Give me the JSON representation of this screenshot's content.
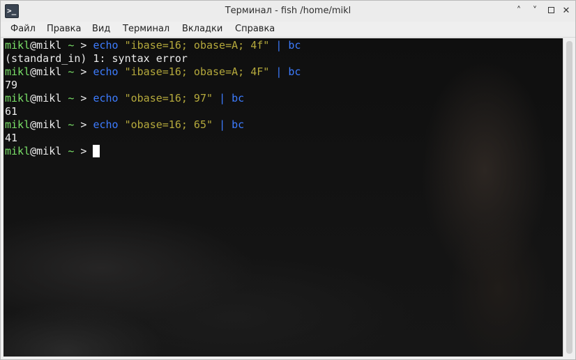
{
  "window": {
    "title": "Терминал - fish /home/mikl",
    "app_icon_glyph": ">_",
    "controls": {
      "minimize": "˄",
      "restore": "˅",
      "close": "✕"
    }
  },
  "menu": {
    "items": [
      "Файл",
      "Правка",
      "Вид",
      "Терминал",
      "Вкладки",
      "Справка"
    ]
  },
  "terminal": {
    "prompt": {
      "user": "mikl",
      "at": "@",
      "host": "mikl",
      "tilde": "~",
      "arrow": ">"
    },
    "lines": [
      {
        "kind": "cmd",
        "cmd": "echo",
        "arg": "\"ibase=16; obase=A; 4f\"",
        "pipe": "|",
        "bin": "bc"
      },
      {
        "kind": "out",
        "text": "(standard_in) 1: syntax error"
      },
      {
        "kind": "cmd",
        "cmd": "echo",
        "arg": "\"ibase=16; obase=A; 4F\"",
        "pipe": "|",
        "bin": "bc"
      },
      {
        "kind": "out",
        "text": "79"
      },
      {
        "kind": "cmd",
        "cmd": "echo",
        "arg": "\"obase=16; 97\"",
        "pipe": "|",
        "bin": "bc"
      },
      {
        "kind": "out",
        "text": "61"
      },
      {
        "kind": "cmd",
        "cmd": "echo",
        "arg": "\"obase=16; 65\"",
        "pipe": "|",
        "bin": "bc"
      },
      {
        "kind": "out",
        "text": "41"
      },
      {
        "kind": "prompt"
      }
    ],
    "colors": {
      "user": "#7ae068",
      "command": "#3d7cff",
      "string": "#b5a93c",
      "text": "#ececec"
    }
  }
}
